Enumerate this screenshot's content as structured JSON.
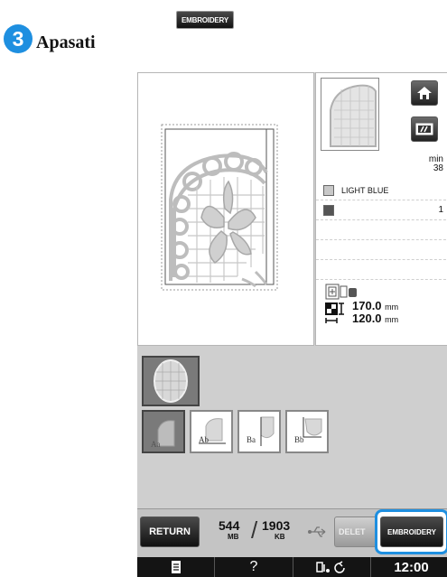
{
  "instruction": {
    "step_number": "3",
    "text": "Apasati",
    "button_image_label": "EMBROIDERY"
  },
  "thread_list": {
    "min_label": "min",
    "total_minutes": "38",
    "rows": [
      {
        "name": "LIGHT BLUE",
        "count": "",
        "color": "#c8c8c8"
      },
      {
        "name": "",
        "count": "1",
        "color": "#555555"
      }
    ]
  },
  "size": {
    "height_value": "170.0",
    "width_value": "120.0",
    "unit": "mm"
  },
  "pattern_strip": {
    "tiles": [
      {
        "label": "Aa",
        "icon": "lace-pattern-aa"
      },
      {
        "label": "Ab",
        "icon": "lace-pattern-ab"
      },
      {
        "label": "Ba",
        "icon": "lace-pattern-ba"
      },
      {
        "label": "Bb",
        "icon": "lace-pattern-bb"
      }
    ]
  },
  "bottom_bar": {
    "return_label": "RETURN",
    "memory_used": "544",
    "memory_used_unit": "MB",
    "memory_free": "1903",
    "memory_free_unit": "KB",
    "delete_label": "DELET",
    "embroidery_label": "EMBROIDERY",
    "highlight_color": "#1e8fe0"
  },
  "status_bar": {
    "help_glyph": "?",
    "clock": "12:00"
  },
  "icons": {
    "home": "home-icon",
    "needle": "needle-mode-icon",
    "usb": "usb-icon",
    "document": "document-icon",
    "bobbin": "bobbin-icon",
    "rotate": "rotate-icon",
    "frame": "frame-size-icon"
  }
}
